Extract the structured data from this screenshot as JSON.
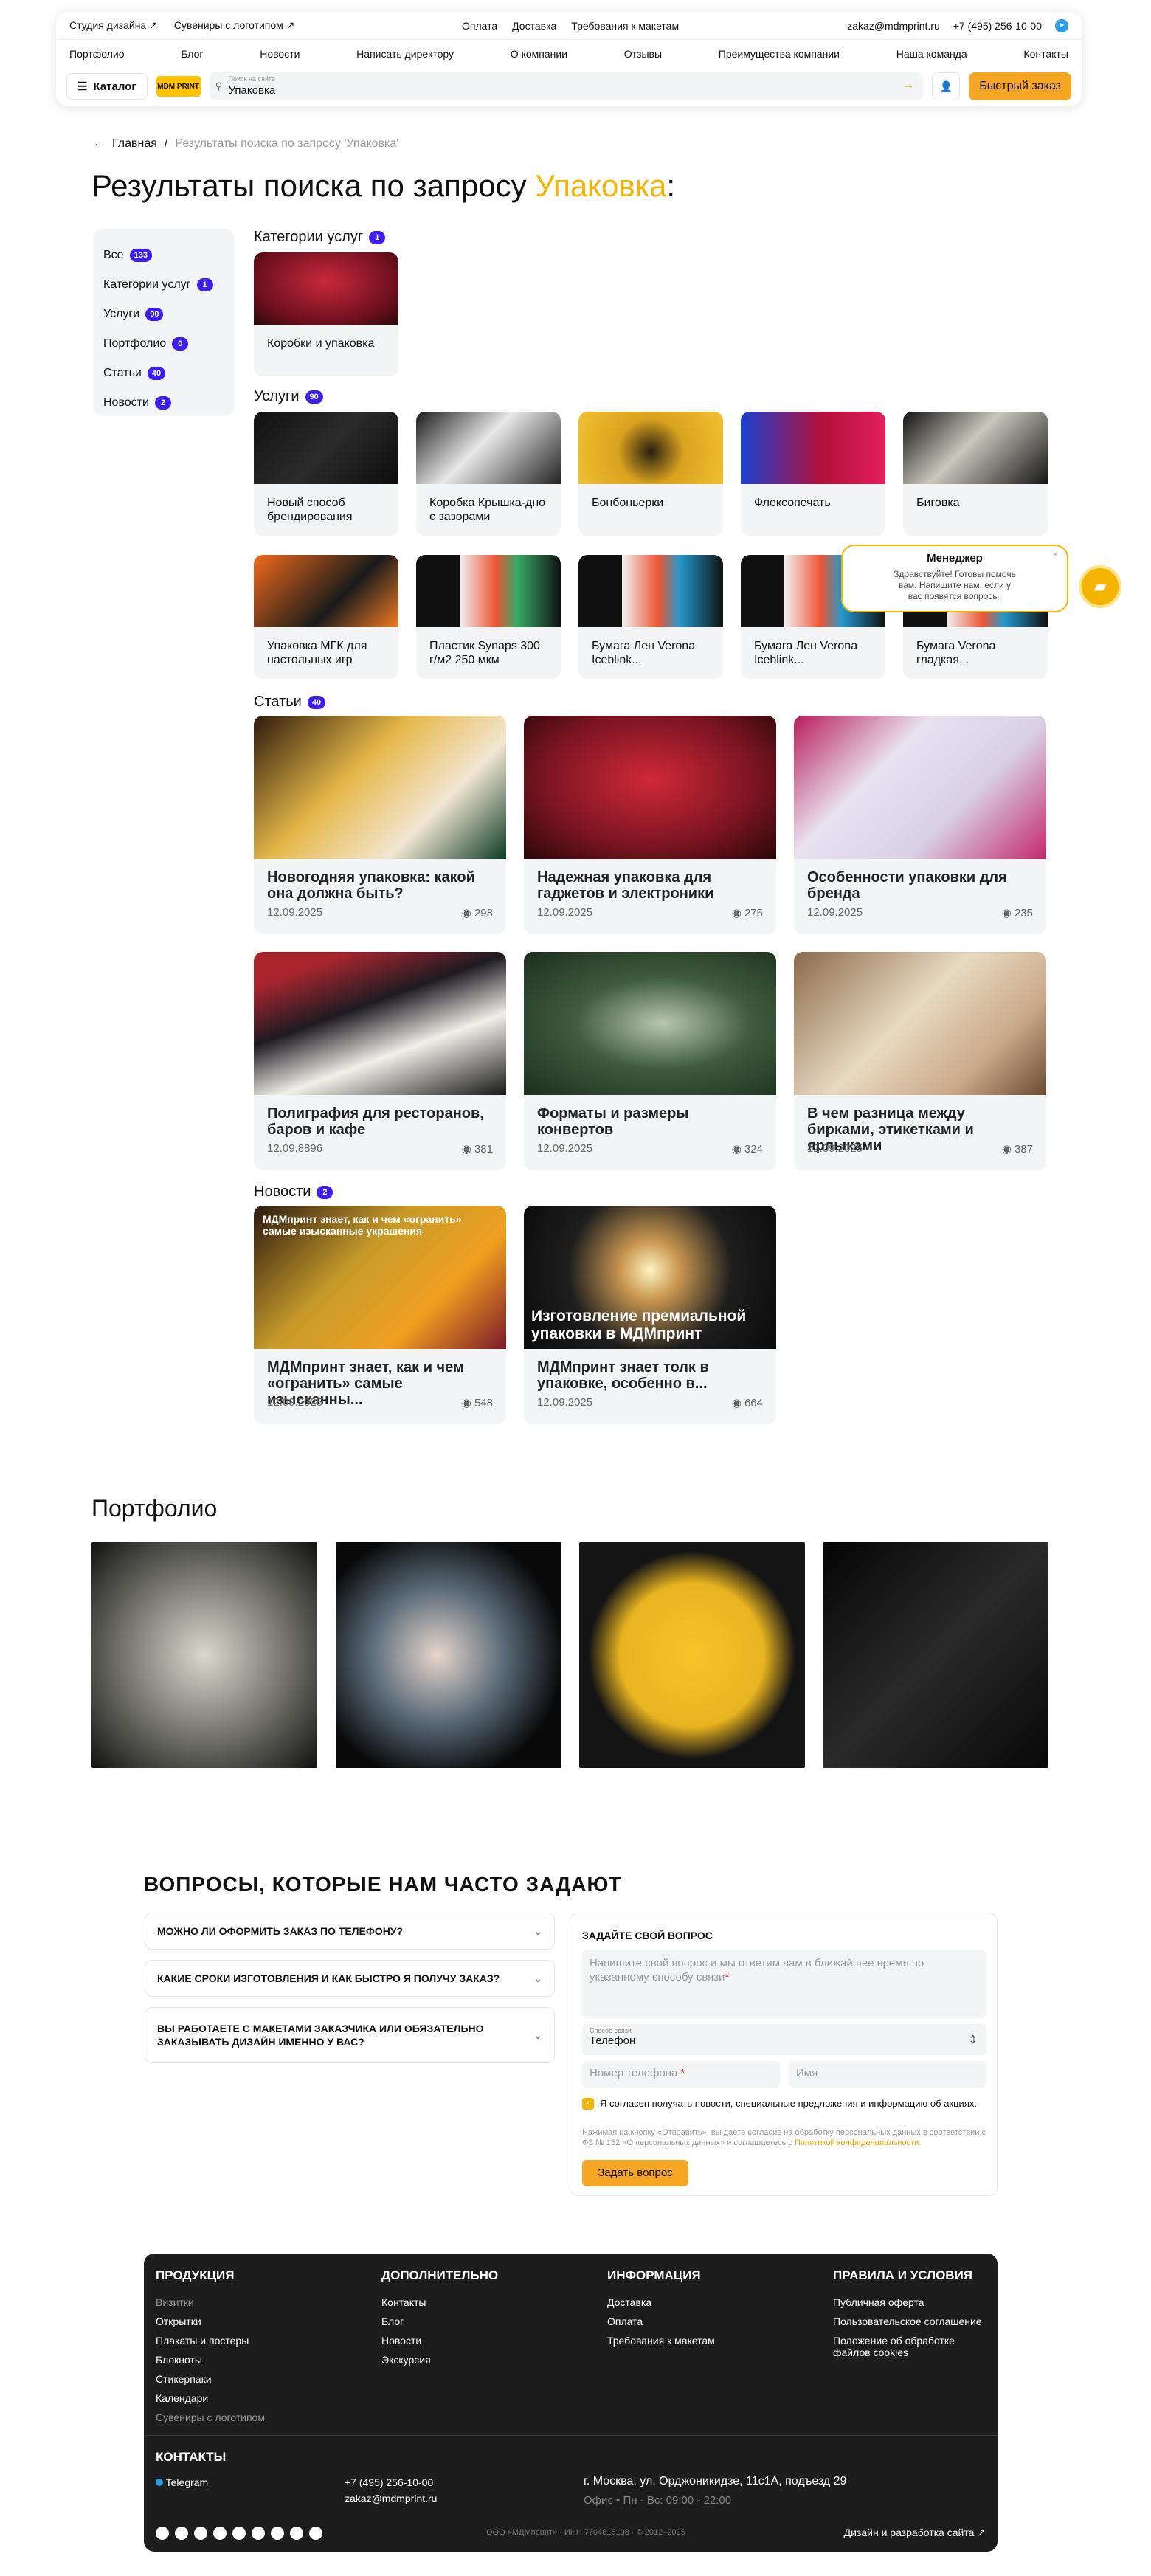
{
  "header": {
    "top_links": [
      "Студия дизайна ↗",
      "Сувениры с логотипом ↗"
    ],
    "center_links": [
      "Оплата",
      "Доставка",
      "Требования к макетам"
    ],
    "email": "zakaz@mdmprint.ru",
    "phone": "+7 (495) 256-10-00",
    "nav": [
      "Портфолио",
      "Блог",
      "Новости",
      "Написать директору",
      "О компании",
      "Отзывы",
      "Преимущества компании",
      "Наша команда",
      "Контакты"
    ],
    "catalog": "Каталог",
    "logo": "MDM PRINT",
    "search_placeholder": "Поиск на сайте",
    "search_value": "Упаковка",
    "quick_order": "Быстрый заказ"
  },
  "breadcrumb": {
    "home": "Главная",
    "current": "Результаты поиска по запросу 'Упаковка'"
  },
  "title": {
    "prefix": "Результаты поиска по запросу ",
    "query": "Упаковка",
    "suffix": ":"
  },
  "filters": [
    {
      "label": "Все",
      "count": "133"
    },
    {
      "label": "Категории услуг",
      "count": "1"
    },
    {
      "label": "Услуги",
      "count": "90"
    },
    {
      "label": "Портфолио",
      "count": "0"
    },
    {
      "label": "Статьи",
      "count": "40"
    },
    {
      "label": "Новости",
      "count": "2"
    }
  ],
  "categories": {
    "title": "Категории услуг",
    "count": "1",
    "items": [
      "Коробки и упаковка"
    ]
  },
  "services": {
    "title": "Услуги",
    "count": "90",
    "items": [
      "Новый способ брендирования",
      "Коробка Крышка-дно с зазорами",
      "Бонбоньерки",
      "Флексопечать",
      "Биговка",
      "Упаковка МГК для настольных игр",
      "Пластик Synaps 300 г/м2 250 мкм",
      "Бумага Лен Verona Iceblink...",
      "Бумага Лен Verona Iceblink...",
      "Бумага Verona гладкая..."
    ]
  },
  "articles": {
    "title": "Статьи",
    "count": "40",
    "items": [
      {
        "title": "Новогодняя упаковка: какой она должна быть?",
        "date": "12.09.2025",
        "views": "298"
      },
      {
        "title": "Надежная упаковка для гаджетов и электроники",
        "date": "12.09.2025",
        "views": "275"
      },
      {
        "title": "Особенности упаковки для бренда",
        "date": "12.09.2025",
        "views": "235"
      },
      {
        "title": "Полиграфия для ресторанов, баров и кафе",
        "date": "12.09.8896",
        "views": "381"
      },
      {
        "title": "Форматы и размеры конвертов",
        "date": "12.09.2025",
        "views": "324"
      },
      {
        "title": "В чем разница между бирками, этикетками и ярлыками",
        "date": "12.09.2025",
        "views": "387"
      }
    ]
  },
  "news": {
    "title": "Новости",
    "count": "2",
    "items": [
      {
        "title": "МДМпринт знает, как и чем «огранить» самые изысканны...",
        "date": "12.09.2025",
        "views": "548",
        "overlay": "МДМпринт знает, как и чем «огранить» самые изысканные украшения"
      },
      {
        "title": "МДМпринт знает толк в упаковке, особенно в...",
        "date": "12.09.2025",
        "views": "664",
        "overlay": "Изготовление премиальной упаковки в МДМпринт"
      }
    ]
  },
  "portfolio": {
    "title": "Портфолио"
  },
  "chat": {
    "title": "Менеджер",
    "message": "Здравствуйте! Готовы помочь вам. Напишите нам, если у вас появятся вопросы."
  },
  "faq": {
    "title": "ВОПРОСЫ, КОТОРЫЕ НАМ ЧАСТО ЗАДАЮТ",
    "items": [
      "МОЖНО ЛИ ОФОРМИТЬ ЗАКАЗ ПО ТЕЛЕФОНУ?",
      "КАКИЕ СРОКИ ИЗГОТОВЛЕНИЯ И КАК БЫСТРО Я ПОЛУЧУ ЗАКАЗ?",
      "ВЫ РАБОТАЕТЕ С МАКЕТАМИ ЗАКАЗЧИКА ИЛИ ОБЯЗАТЕЛЬНО ЗАКАЗЫВАТЬ ДИЗАЙН ИМЕННО У ВАС?"
    ]
  },
  "form": {
    "title": "ЗАДАЙТЕ СВОЙ ВОПРОС",
    "question_ph": "Напишите свой вопрос и мы ответим вам в ближайшее время по указанному способу связи",
    "contact_label": "Способ связи",
    "contact_value": "Телефон",
    "phone_ph": "Номер телефона",
    "name_ph": "Имя",
    "consent": "Я согласен получать новости, специальные предложения и информацию об акциях.",
    "legal": "Нажимая на кнопку «Отправить», вы даёте согласие на обработку персональных данных в соответствии с ФЗ № 152 «О персональных данных» и соглашаетесь с",
    "legal_link": "Политикой конфиденциальности.",
    "submit": "Задать вопрос"
  },
  "footer": {
    "cols": [
      {
        "title": "ПРОДУКЦИЯ",
        "items": [
          "Визитки",
          "Открытки",
          "Плакаты и постеры",
          "Блокноты",
          "Стикерпаки",
          "Календари",
          "Сувениры с логотипом"
        ]
      },
      {
        "title": "ДОПОЛНИТЕЛЬНО",
        "items": [
          "Контакты",
          "Блог",
          "Новости",
          "Экскурсия"
        ]
      },
      {
        "title": "ИНФОРМАЦИЯ",
        "items": [
          "Доставка",
          "Оплата",
          "Требования к макетам"
        ]
      },
      {
        "title": "ПРАВИЛА И УСЛОВИЯ",
        "items": [
          "Публичная оферта",
          "Пользовательское соглашение",
          "Положение об обработке файлов cookies"
        ]
      }
    ],
    "contacts_title": "КОНТАКТЫ",
    "telegram": "Telegram",
    "phone": "+7 (495) 256-10-00",
    "email": "zakaz@mdmprint.ru",
    "address": "г. Москва, ул. Орджоникидзе, 11с1А, подъезд 29",
    "hours": "Офис • Пн - Вс: 09:00 - 22:00",
    "legal": "ООО «МДМпринт» · ИНН 7704815108 · © 2012–2025",
    "dev": "Дизайн и разработка сайта ↗"
  }
}
